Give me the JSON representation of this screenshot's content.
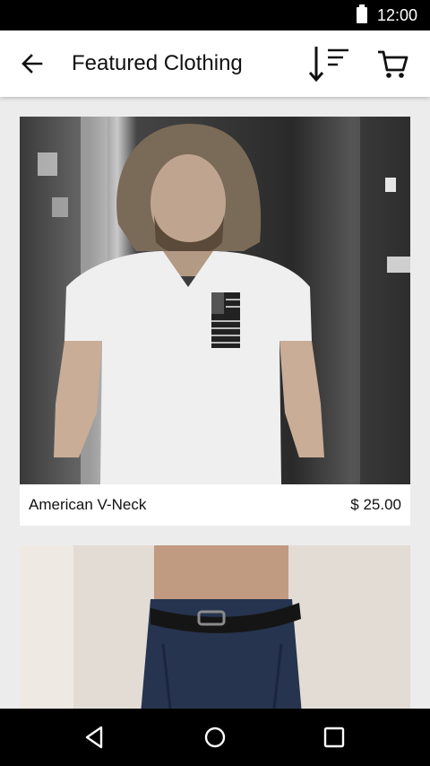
{
  "status_bar": {
    "time": "12:00",
    "battery_icon": "battery-full-icon"
  },
  "app_bar": {
    "title": "Featured Clothing",
    "back_icon": "arrow-back-icon",
    "sort_icon": "sort-icon",
    "cart_icon": "cart-icon"
  },
  "products": [
    {
      "name": "American V-Neck",
      "price": "$ 25.00"
    },
    {
      "name": "",
      "price": ""
    }
  ],
  "nav_bar": {
    "back_icon": "nav-back-icon",
    "home_icon": "nav-home-icon",
    "recents_icon": "nav-recents-icon"
  },
  "colors": {
    "status_bar": "#000000",
    "app_bar": "#ffffff",
    "background": "#ececec",
    "text": "#111111"
  }
}
